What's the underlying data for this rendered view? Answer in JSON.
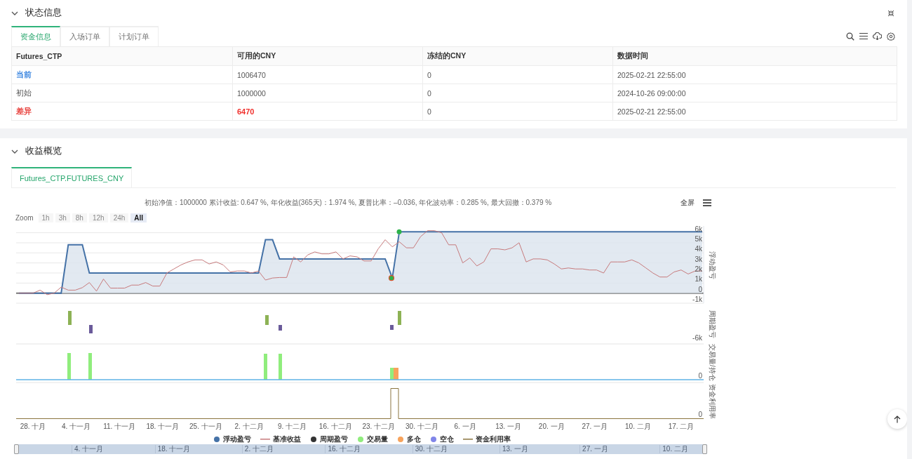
{
  "status_panel": {
    "title": "状态信息",
    "tabs": [
      {
        "label": "资金信息",
        "selected": true
      },
      {
        "label": "入场订单",
        "selected": false
      },
      {
        "label": "计划订单",
        "selected": false
      }
    ],
    "table": {
      "columns": [
        "Futures_CTP",
        "可用的CNY",
        "冻结的CNY",
        "数据时间"
      ],
      "rows": [
        {
          "cells": [
            {
              "text": "当前",
              "color": "#3b86e0"
            },
            {
              "text": "1006470"
            },
            {
              "text": "0"
            },
            {
              "text": "2025-02-21 22:55:00"
            }
          ]
        },
        {
          "cells": [
            {
              "text": "初始"
            },
            {
              "text": "1000000"
            },
            {
              "text": "0"
            },
            {
              "text": "2024-10-26 09:00:00"
            }
          ]
        },
        {
          "cells": [
            {
              "text": "差异",
              "color": "#e8403c"
            },
            {
              "text": "6470",
              "color": "#f0302c"
            },
            {
              "text": "0"
            },
            {
              "text": "2025-02-21 22:55:00"
            }
          ]
        }
      ]
    }
  },
  "overview_panel": {
    "title": "收益概览",
    "tabs": [
      {
        "label": "Futures_CTP.FUTURES_CNY",
        "selected": true
      }
    ],
    "chart_title": "初始净值：1000000 累计收益: 0.647 %, 年化收益(365天)：1.974 %, 夏普比率：–0.036, 年化波动率：0.285 %, 最大回撤：0.379 %",
    "fullscreen": "全屏",
    "zoom": {
      "label": "Zoom",
      "buttons": [
        {
          "label": "1h",
          "selected": false
        },
        {
          "label": "3h",
          "selected": false
        },
        {
          "label": "8h",
          "selected": false
        },
        {
          "label": "12h",
          "selected": false
        },
        {
          "label": "24h",
          "selected": false
        },
        {
          "label": "All",
          "selected": true
        }
      ]
    },
    "chart_data": {
      "type": "area",
      "ylabel": "浮动盈亏",
      "ylim": [
        -1,
        6.6
      ],
      "grid": true,
      "series": [
        {
          "name": "浮动盈亏",
          "color": "#4572a7",
          "values": [
            0,
            0,
            0,
            0,
            0,
            0,
            0,
            4.8,
            4.8,
            4.8,
            2,
            2,
            2,
            2,
            2,
            2,
            2,
            2,
            2,
            2,
            2,
            2,
            2,
            2,
            2,
            2,
            2,
            2,
            2,
            2,
            2,
            2,
            2,
            2,
            2,
            5.3,
            5.3,
            3.4,
            3.4,
            3.4,
            3.4,
            3.4,
            3.4,
            3.4,
            3.4,
            3.4,
            3.4,
            3.4,
            3.4,
            3.4,
            3.4,
            3.4,
            3.4,
            1.5,
            6.1,
            6.1,
            6.1,
            6.1,
            6.1,
            6.1,
            6.1,
            6.1,
            6.1,
            6.1,
            6.1,
            6.1,
            6.1,
            6.1,
            6.1,
            6.1,
            6.1,
            6.1,
            6.1,
            6.1,
            6.1,
            6.1,
            6.1,
            6.1,
            6.1,
            6.1,
            6.1,
            6.1,
            6.1,
            6.1,
            6.1,
            6.1,
            6.1,
            6.1,
            6.1,
            6.1,
            6.1,
            6.1,
            6.1,
            6.1,
            6.1,
            6.1,
            6.1,
            6.1
          ]
        },
        {
          "name": "基准收益",
          "color": "#c77a7c",
          "type": "line",
          "values": [
            0,
            0,
            0,
            0.3,
            -0.15,
            0,
            0.6,
            0.3,
            0.3,
            0.55,
            1.05,
            0.2,
            1.4,
            0.5,
            0.5,
            0.5,
            0.8,
            0.8,
            1.05,
            0.7,
            0.7,
            2.0,
            2.4,
            2.8,
            3.1,
            3.3,
            3.3,
            2.9,
            3.1,
            2.8,
            2.1,
            2.2,
            2.2,
            2.0,
            2.2,
            1.3,
            1.5,
            1.55,
            1.55,
            3.6,
            3.1,
            3.8,
            4.1,
            3.9,
            3.9,
            4.1,
            3.4,
            3.7,
            3.6,
            3.2,
            3.2,
            4.4,
            5.3,
            4.6,
            5.1,
            4.5,
            4.5,
            5.6,
            6.2,
            6.2,
            6.0,
            4.8,
            4.8,
            3.0,
            3.5,
            2.7,
            3.1,
            4.4,
            4.4,
            4.3,
            4.5,
            5.0,
            3.1,
            3.4,
            3.4,
            3.3,
            2.9,
            2.4,
            2.5,
            2.4,
            2.4,
            2.3,
            2.3,
            2.0,
            3.1,
            3.1,
            3.1,
            3.3,
            3.0,
            2.5,
            2.0,
            1.6,
            1.6,
            2.1,
            2.3,
            1.9,
            2.2,
            2.2
          ]
        }
      ],
      "yticks": [
        {
          "value": -1,
          "label": "-1k"
        },
        {
          "value": 0,
          "label": "0"
        },
        {
          "value": 1,
          "label": "1k"
        },
        {
          "value": 2,
          "label": "2k"
        },
        {
          "value": 3,
          "label": "3k"
        },
        {
          "value": 4,
          "label": "4k"
        },
        {
          "value": 5,
          "label": "5k"
        },
        {
          "value": 6,
          "label": "6k"
        }
      ]
    },
    "panels": [
      {
        "kind": "pnl_bars",
        "title": "周期盈亏",
        "tick": "-6k"
      },
      {
        "kind": "volume_bars",
        "title": "交易量/持仓",
        "tick": "0"
      },
      {
        "kind": "usage_line",
        "title": "资金利用率",
        "tick": "0"
      }
    ],
    "date_labels": [
      "28. 十月",
      "4. 十一月",
      "11. 十一月",
      "18. 十一月",
      "25. 十一月",
      "2. 十二月",
      "9. 十二月",
      "16. 十二月",
      "23. 十二月",
      "30. 十二月",
      "6. 一月",
      "13. 一月",
      "20. 一月",
      "27. 一月",
      "10. 二月",
      "17. 二月"
    ],
    "legend": [
      {
        "label": "周期盈亏",
        "kind": "dot",
        "color": "#333333"
      },
      {
        "label": "交易量",
        "kind": "dot",
        "color": "#90ed7d"
      },
      {
        "label": "多仓",
        "kind": "dot",
        "color": "#f7a35c"
      },
      {
        "label": "空仓",
        "kind": "dot",
        "color": "#8085e9"
      },
      {
        "label": "资金利用率",
        "kind": "line",
        "color": "#8b7540"
      }
    ],
    "navigator_labels": [
      "4. 十一月",
      "18. 十一月",
      "2. 十二月",
      "16. 十二月",
      "30. 十二月",
      "13. 一月",
      "27. 一月",
      "10. 二月"
    ]
  }
}
